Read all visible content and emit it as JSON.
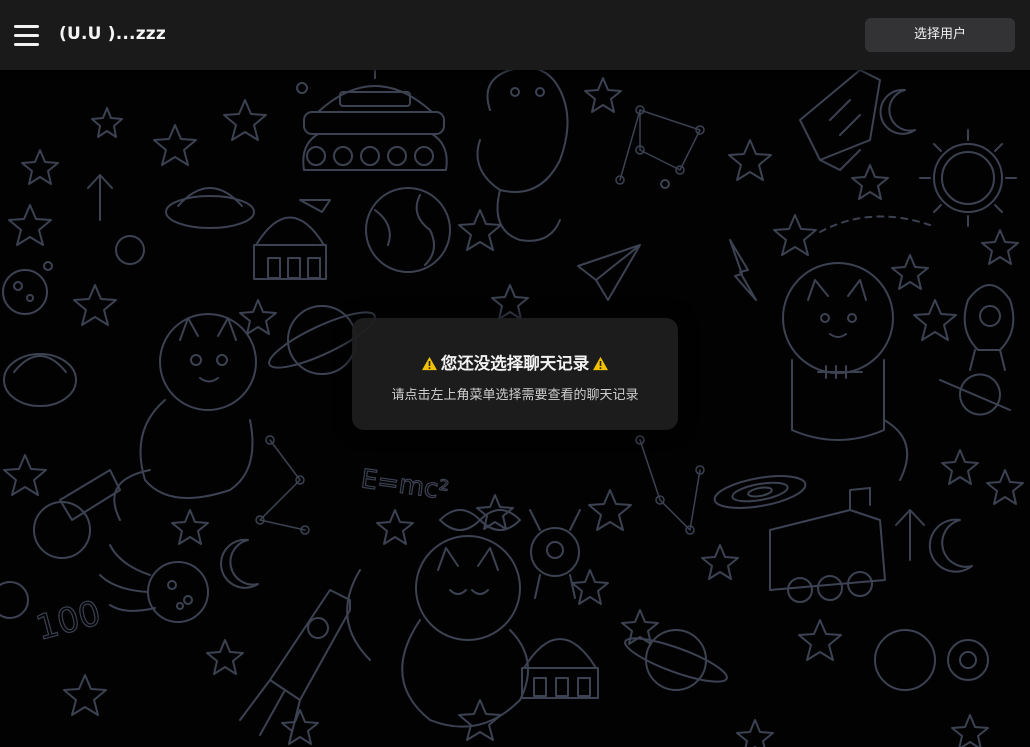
{
  "header": {
    "title": "(U.U )...zzz",
    "select_user_label": "选择用户",
    "menu_icon": "hamburger-menu-icon"
  },
  "notice": {
    "title": "您还没选择聊天记录",
    "subtitle": "请点击左上角菜单选择需要查看的聊天记录",
    "icon": "warning-icon"
  },
  "background": {
    "formula": "E=mc²",
    "numeral": "100"
  },
  "colors": {
    "background": "#020203",
    "topbar": "#1a1a1b",
    "doodle_line": "#3c4252",
    "button": "#333335",
    "warning": "#f2c200"
  }
}
